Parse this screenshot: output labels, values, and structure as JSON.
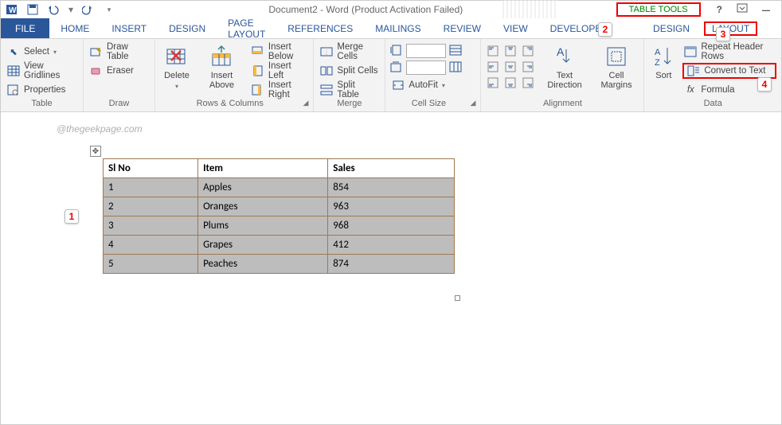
{
  "title": "Document2 - Word (Product Activation Failed)",
  "table_tools_label": "TABLE TOOLS",
  "tabs": {
    "file": "FILE",
    "home": "HOME",
    "insert": "INSERT",
    "design": "DESIGN",
    "page_layout": "PAGE LAYOUT",
    "references": "REFERENCES",
    "mailings": "MAILINGS",
    "review": "REVIEW",
    "view": "VIEW",
    "developer": "DEVELOPER",
    "tt_design": "DESIGN",
    "tt_layout": "LAYOUT"
  },
  "ribbon": {
    "table_group": {
      "select": "Select",
      "view_gridlines": "View Gridlines",
      "properties": "Properties",
      "label": "Table"
    },
    "draw_group": {
      "draw_table": "Draw Table",
      "eraser": "Eraser",
      "label": "Draw"
    },
    "rows_cols": {
      "delete": "Delete",
      "insert_above": "Insert Above",
      "insert_below": "Insert Below",
      "insert_left": "Insert Left",
      "insert_right": "Insert Right",
      "label": "Rows & Columns"
    },
    "merge": {
      "merge_cells": "Merge Cells",
      "split_cells": "Split Cells",
      "split_table": "Split Table",
      "label": "Merge"
    },
    "cell_size": {
      "autofit": "AutoFit",
      "label": "Cell Size"
    },
    "alignment": {
      "text_direction": "Text Direction",
      "cell_margins": "Cell Margins",
      "label": "Alignment"
    },
    "data": {
      "sort": "Sort",
      "repeat_header": "Repeat Header Rows",
      "convert_to_text": "Convert to Text",
      "formula": "Formula",
      "label": "Data"
    }
  },
  "annotations": {
    "n1": "1",
    "n2": "2",
    "n3": "3",
    "n4": "4"
  },
  "watermark": "@thegeekpage.com",
  "chart_data": {
    "type": "table",
    "headers": [
      "Sl No",
      "Item",
      "Sales"
    ],
    "rows": [
      [
        "1",
        "Apples",
        "854"
      ],
      [
        "2",
        "Oranges",
        "963"
      ],
      [
        "3",
        "Plums",
        "968"
      ],
      [
        "4",
        "Grapes",
        "412"
      ],
      [
        "5",
        "Peaches",
        "874"
      ]
    ]
  }
}
